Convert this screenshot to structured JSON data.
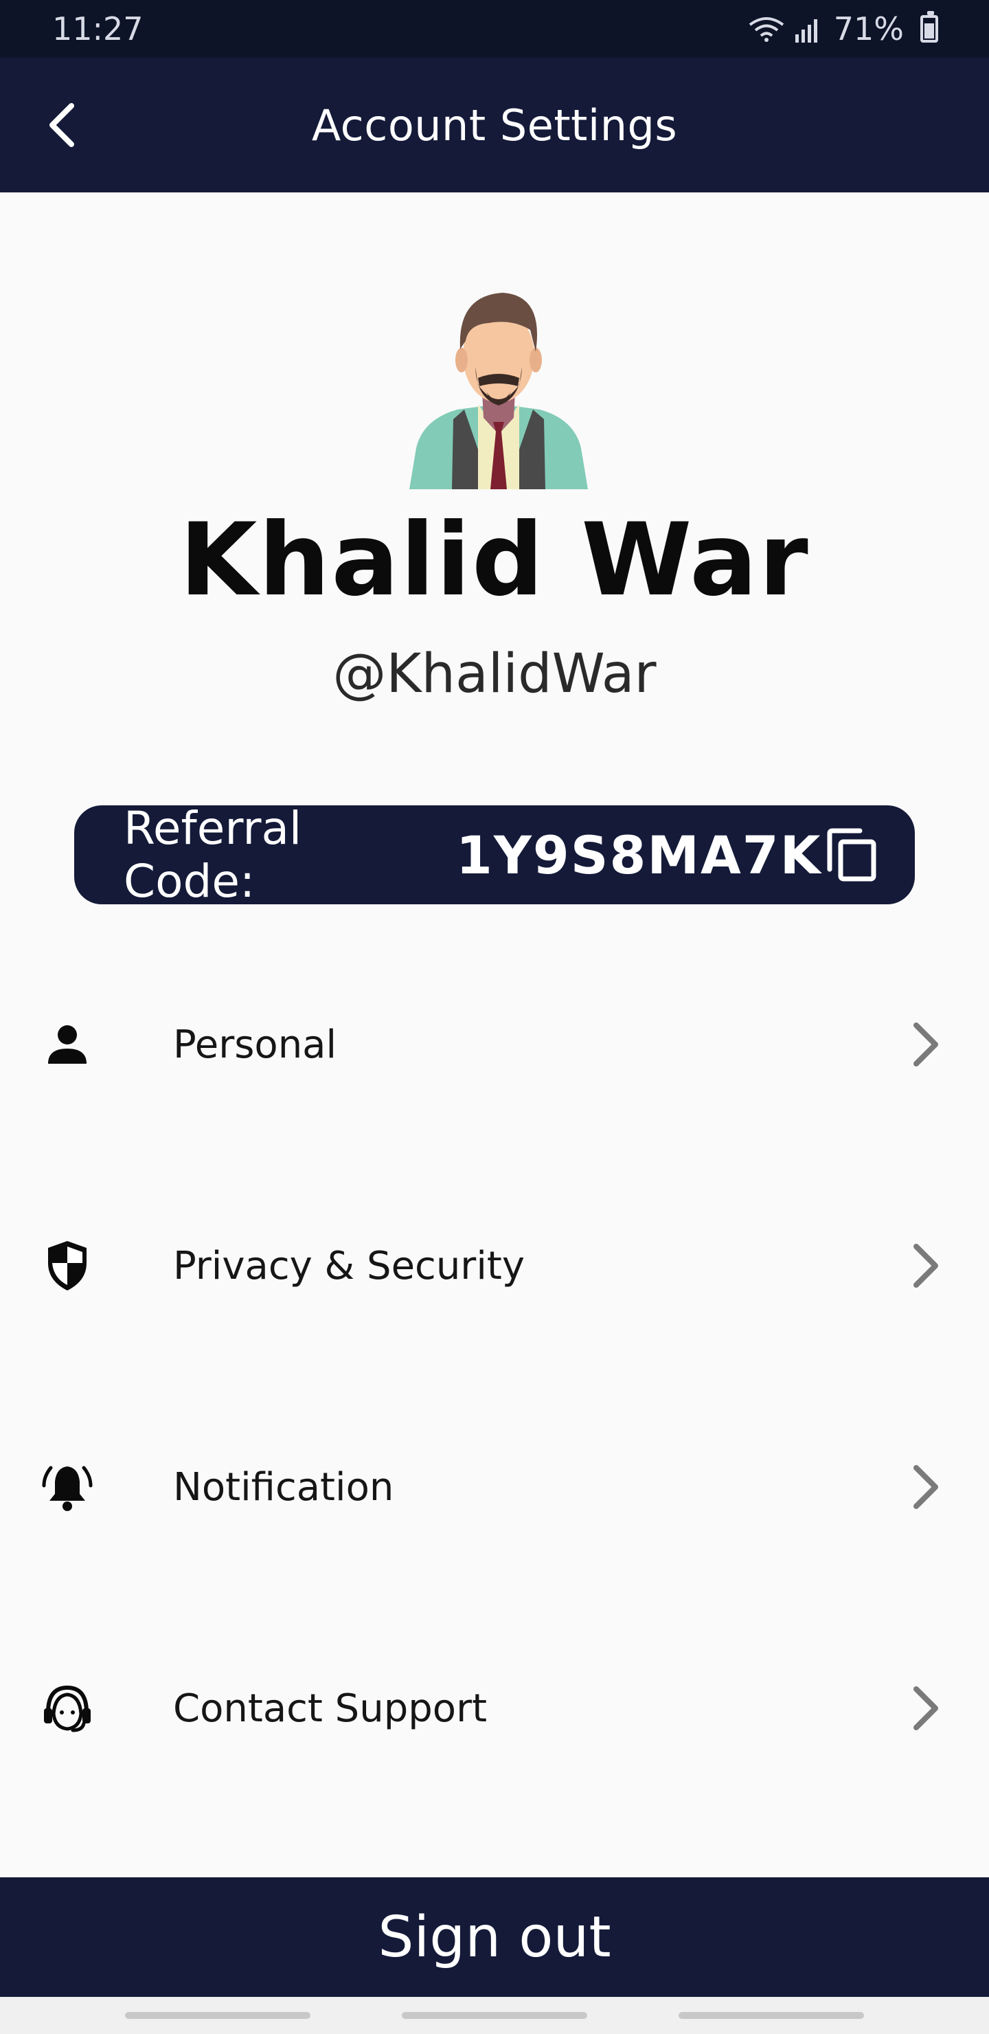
{
  "status_bar": {
    "time": "11:27",
    "battery_percent": "71%",
    "icons": [
      "wifi-icon",
      "signal-icon",
      "battery-icon"
    ]
  },
  "app_bar": {
    "title": "Account Settings",
    "back_icon": "chevron-left-icon"
  },
  "profile": {
    "name": "Khalid War",
    "handle": "@KhalidWar",
    "avatar_icon": "user-avatar-illustration"
  },
  "referral": {
    "label": "Referral Code:",
    "code": "1Y9S8MA7K",
    "copy_icon": "copy-icon"
  },
  "menu": {
    "items": [
      {
        "label": "Personal",
        "icon": "person-icon"
      },
      {
        "label": "Privacy & Security",
        "icon": "shield-icon"
      },
      {
        "label": "Notification",
        "icon": "bell-icon"
      },
      {
        "label": "Contact Support",
        "icon": "headset-icon"
      }
    ]
  },
  "actions": {
    "signout_label": "Sign out"
  },
  "colors": {
    "primary": "#141a38",
    "status_bar": "#0e1428",
    "background": "#fafafa",
    "avatar_shirt": "#82cbb7",
    "avatar_tie": "#7d2030"
  }
}
